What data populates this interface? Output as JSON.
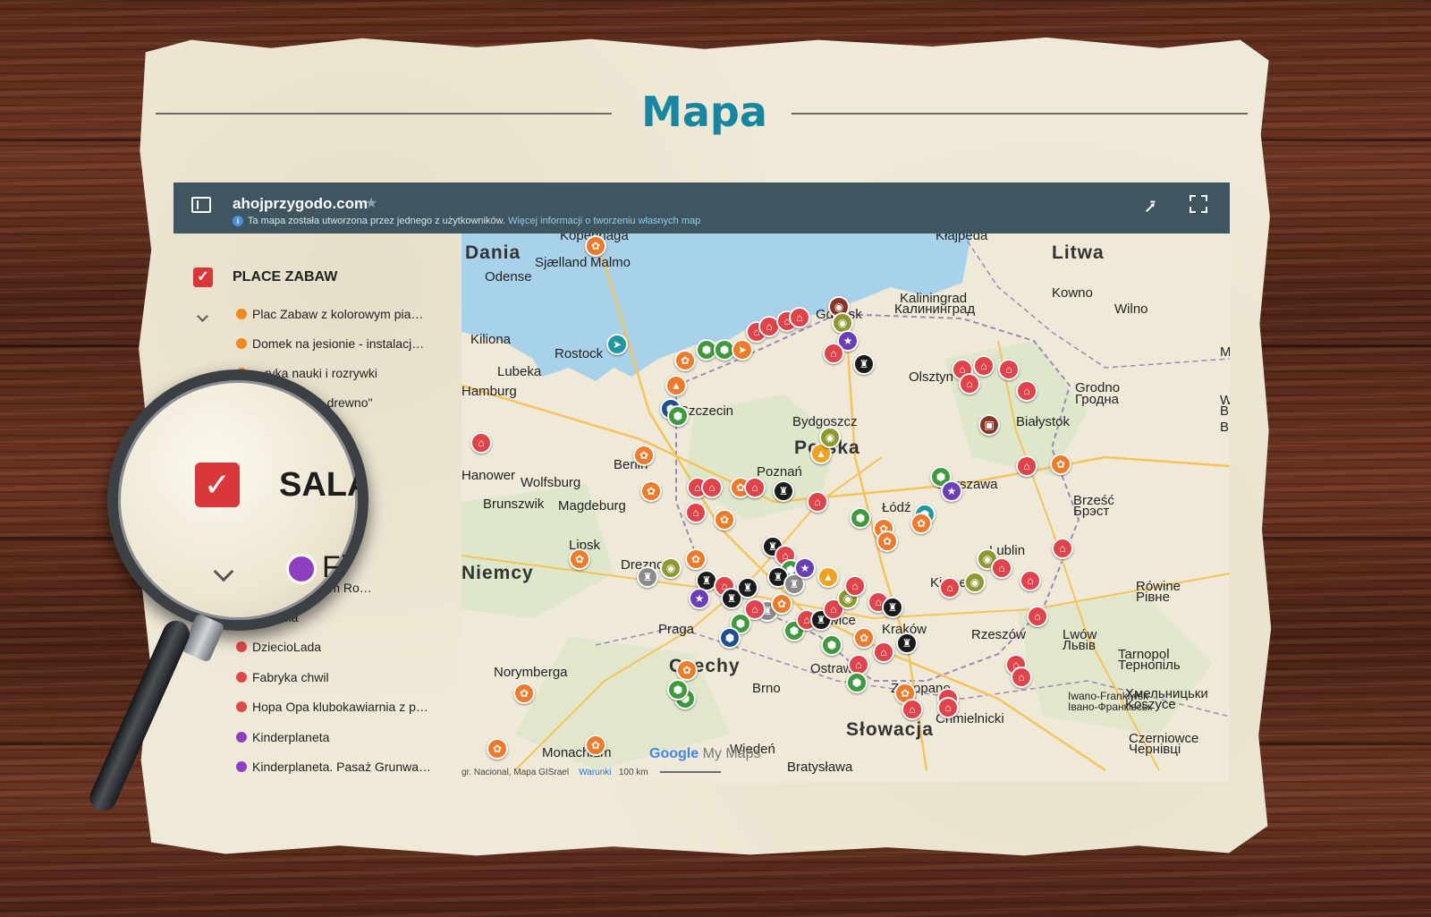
{
  "page": {
    "title": "Mapa"
  },
  "map_header": {
    "site": "ahojprzygodo.com",
    "note": "Ta mapa została utworzona przez jednego z użytkowników.",
    "note_link": "Więcej informacji o tworzeniu własnych map"
  },
  "legend": {
    "layer_title": "PLACE ZABAW",
    "items": [
      {
        "label": "Plac Zabaw z kolorowym pia…",
        "color": "#f08a1c"
      },
      {
        "label": "Domek na jesionie - instalacj…",
        "color": "#f08a1c"
      },
      {
        "label": "…ryka nauki i rozrywki",
        "color": "#f08a1c"
      },
      {
        "label": "…\"Naturalne drewno\"",
        "color": "#f08a1c"
      },
      {
        "label": "…nia i sala za…",
        "color": "#8e3fbf"
      },
      {
        "label": "…ow - Centrum Ro…",
        "color": "#8e3fbf"
      },
      {
        "label": "…landia",
        "color": "#e04848"
      },
      {
        "label": "DziecioLada",
        "color": "#e04848"
      },
      {
        "label": "Fabryka chwil",
        "color": "#e04848"
      },
      {
        "label": "Hopa Opa klubokawiarnia z p…",
        "color": "#e04848"
      },
      {
        "label": "Kinderplaneta",
        "color": "#8e3fbf"
      },
      {
        "label": "Kinderplaneta. Pasaż Grunwa…",
        "color": "#8e3fbf"
      }
    ]
  },
  "magnifier": {
    "check": "✓",
    "text": "SALA",
    "item_text": "Fi"
  },
  "map_places": {
    "big": [
      "Dania",
      "Litwa",
      "Polska",
      "Niemcy",
      "Czechy",
      "Słowacja"
    ],
    "cities": [
      "Kopenhaga",
      "Sjælland",
      "Malmo",
      "Odense",
      "Kiliona",
      "Rostock",
      "Lubeka",
      "Hamburg",
      "Szczecin",
      "Kaliningrad",
      "Калининград",
      "Kłajpeda",
      "Kowno",
      "Wilno",
      "Olsztyn",
      "Grodno",
      "Гродна",
      "Białystok",
      "Bydgoszcz",
      "Poznań",
      "Berlin",
      "Hanower",
      "Wolfsburg",
      "Brunszwik",
      "Magdeburg",
      "Lipsk",
      "Drezno",
      "Warszawa",
      "Łódź",
      "Brześć",
      "Брэст",
      "Lublin",
      "Kielce",
      "Rówine",
      "Рівне",
      "Praga",
      "Katowice",
      "Kraków",
      "Rzeszów",
      "Lwów",
      "Львів",
      "Tarnopol",
      "Тернопіль",
      "Norymberga",
      "Brno",
      "Ostrawa",
      "Zakopane",
      "Iwano-Frankiwsk",
      "Івано-Франківськ",
      "Chmielnicki",
      "Хмельницьки",
      "Koszyce",
      "Czerniowce",
      "Чернівці",
      "Monachium",
      "Wiedeń",
      "Bratysława",
      "Gdańsk",
      "Mi",
      "Witów",
      "Віцебск",
      "B"
    ]
  },
  "map_footer": {
    "attribution": "gr. Nacional, Mapa GISrael",
    "terms": "Warunki",
    "scale": "100 km",
    "brand_google": "Google",
    "brand_mymaps": "My Maps"
  },
  "markers": {
    "colors": {
      "red": "#e0434a",
      "orange": "#ef7a2a",
      "black": "#1b1b1b",
      "green": "#3e9a3c",
      "olive": "#8c9a2d",
      "purple": "#6a3fb5",
      "teal": "#1f98a0",
      "brown": "#8a3524",
      "amber": "#f0a321",
      "navy": "#1d4f91",
      "gray": "#8b8b8b"
    }
  }
}
